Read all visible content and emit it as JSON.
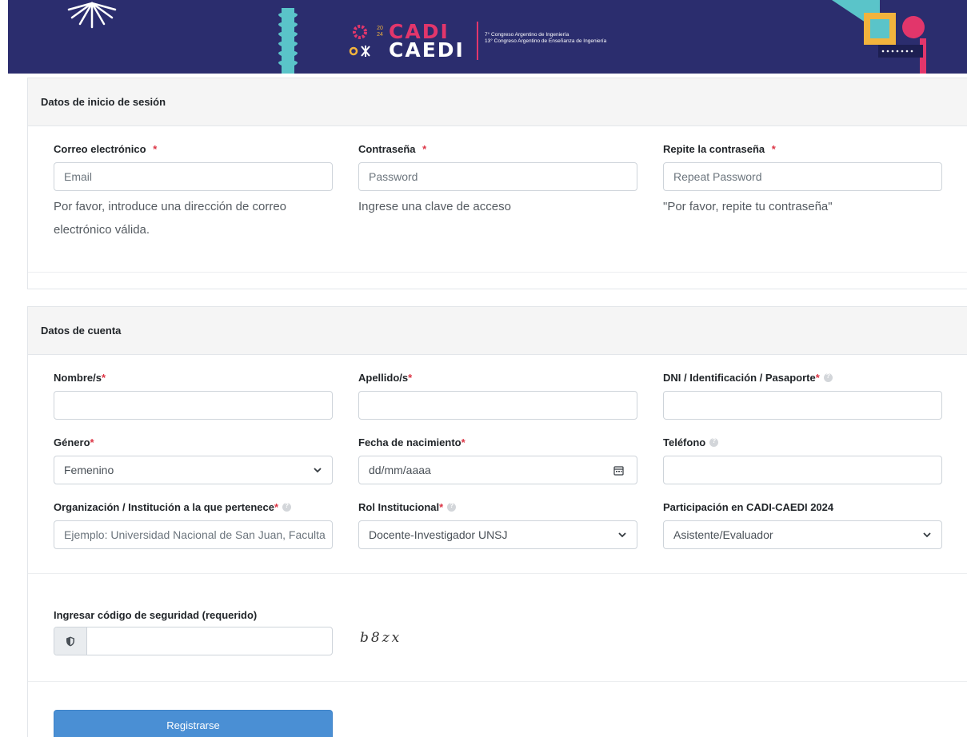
{
  "banner": {
    "brand_top": "CADI",
    "brand_bottom": "CAEDI",
    "year": "20 24",
    "congress_line1": "7° Congreso Argentino de Ingeniería",
    "congress_line2": "13° Congreso Argentino de Enseñanza de Ingeniería",
    "colors": {
      "background": "#2b2d6e",
      "pink": "#e2366b",
      "teal": "#5ac4c9",
      "yellow": "#f2b33d"
    }
  },
  "login_section": {
    "title": "Datos de inicio de sesión",
    "email": {
      "label": "Correo electrónico",
      "required_mark": "*",
      "placeholder": "Email",
      "hint": "Por favor, introduce una dirección de correo electrónico válida."
    },
    "password": {
      "label": "Contraseña",
      "required_mark": "*",
      "placeholder": "Password",
      "hint": "Ingrese una clave de acceso"
    },
    "repeat_password": {
      "label": "Repite la contraseña",
      "required_mark": "*",
      "placeholder": "Repeat Password",
      "hint": "\"Por favor, repite tu contraseña\""
    }
  },
  "account_section": {
    "title": "Datos de cuenta",
    "first_name": {
      "label": "Nombre/s",
      "required_mark": "*",
      "value": ""
    },
    "last_name": {
      "label": "Apellido/s",
      "required_mark": "*",
      "value": ""
    },
    "dni": {
      "label": "DNI / Identificación / Pasaporte",
      "required_mark": "*",
      "value": ""
    },
    "gender": {
      "label": "Género",
      "required_mark": "*",
      "value": "Femenino"
    },
    "birth_date": {
      "label": "Fecha de nacimiento",
      "required_mark": "*",
      "value": "dd/mm/aaaa"
    },
    "phone": {
      "label": "Teléfono",
      "value": ""
    },
    "organization": {
      "label": "Organización / Institución a la que pertenece",
      "required_mark": "*",
      "placeholder": "Ejemplo: Universidad Nacional de San Juan, Faculta"
    },
    "role": {
      "label": "Rol Institucional",
      "required_mark": "*",
      "value": "Docente-Investigador UNSJ"
    },
    "participation": {
      "label": "Participación en CADI-CAEDI 2024",
      "value": "Asistente/Evaluador"
    }
  },
  "captcha": {
    "label": "Ingresar código de seguridad (requerido)",
    "code": "b8zx",
    "value": ""
  },
  "submit": {
    "label": "Registrarse",
    "color": "#4a8fd4"
  }
}
